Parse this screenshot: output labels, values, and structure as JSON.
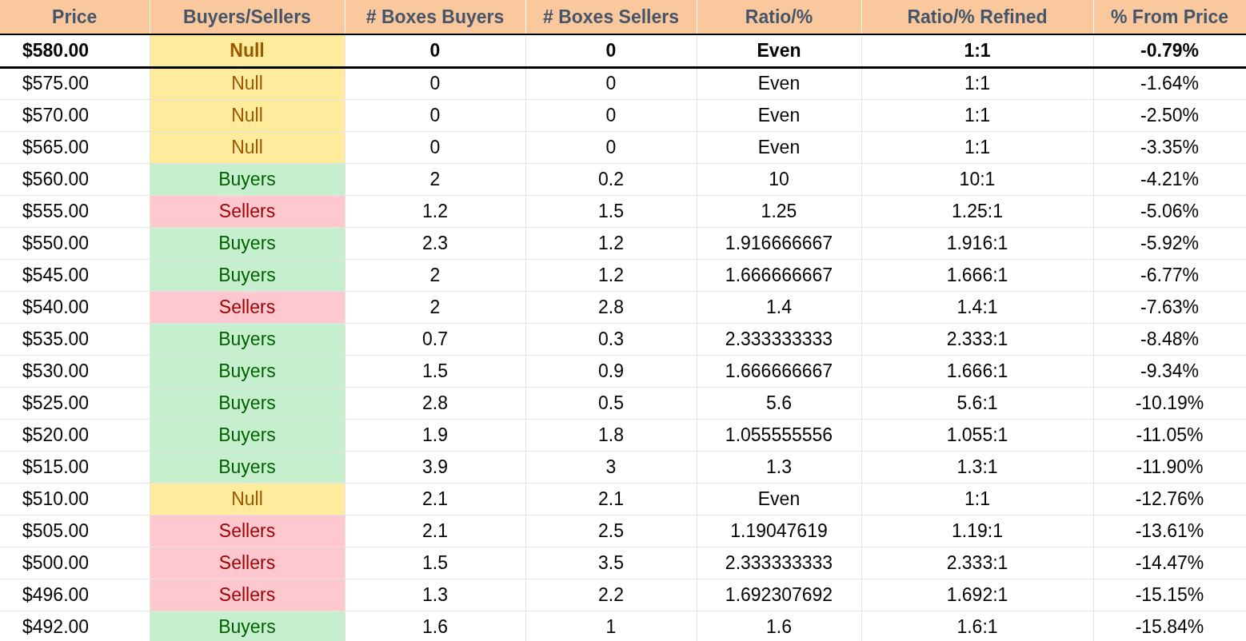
{
  "table": {
    "columns": [
      "Price",
      "Buyers/Sellers",
      "# Boxes Buyers",
      "# Boxes Sellers",
      "Ratio/%",
      "Ratio/% Refined",
      "% From Price"
    ],
    "rows": [
      {
        "current": true,
        "kind": "null",
        "cells": [
          "$580.00",
          "Null",
          "0",
          "0",
          "Even",
          "1:1",
          "-0.79%"
        ]
      },
      {
        "current": false,
        "kind": "null",
        "cells": [
          "$575.00",
          "Null",
          "0",
          "0",
          "Even",
          "1:1",
          "-1.64%"
        ]
      },
      {
        "current": false,
        "kind": "null",
        "cells": [
          "$570.00",
          "Null",
          "0",
          "0",
          "Even",
          "1:1",
          "-2.50%"
        ]
      },
      {
        "current": false,
        "kind": "null",
        "cells": [
          "$565.00",
          "Null",
          "0",
          "0",
          "Even",
          "1:1",
          "-3.35%"
        ]
      },
      {
        "current": false,
        "kind": "buyers",
        "cells": [
          "$560.00",
          "Buyers",
          "2",
          "0.2",
          "10",
          "10:1",
          "-4.21%"
        ]
      },
      {
        "current": false,
        "kind": "sellers",
        "cells": [
          "$555.00",
          "Sellers",
          "1.2",
          "1.5",
          "1.25",
          "1.25:1",
          "-5.06%"
        ]
      },
      {
        "current": false,
        "kind": "buyers",
        "cells": [
          "$550.00",
          "Buyers",
          "2.3",
          "1.2",
          "1.916666667",
          "1.916:1",
          "-5.92%"
        ]
      },
      {
        "current": false,
        "kind": "buyers",
        "cells": [
          "$545.00",
          "Buyers",
          "2",
          "1.2",
          "1.666666667",
          "1.666:1",
          "-6.77%"
        ]
      },
      {
        "current": false,
        "kind": "sellers",
        "cells": [
          "$540.00",
          "Sellers",
          "2",
          "2.8",
          "1.4",
          "1.4:1",
          "-7.63%"
        ]
      },
      {
        "current": false,
        "kind": "buyers",
        "cells": [
          "$535.00",
          "Buyers",
          "0.7",
          "0.3",
          "2.333333333",
          "2.333:1",
          "-8.48%"
        ]
      },
      {
        "current": false,
        "kind": "buyers",
        "cells": [
          "$530.00",
          "Buyers",
          "1.5",
          "0.9",
          "1.666666667",
          "1.666:1",
          "-9.34%"
        ]
      },
      {
        "current": false,
        "kind": "buyers",
        "cells": [
          "$525.00",
          "Buyers",
          "2.8",
          "0.5",
          "5.6",
          "5.6:1",
          "-10.19%"
        ]
      },
      {
        "current": false,
        "kind": "buyers",
        "cells": [
          "$520.00",
          "Buyers",
          "1.9",
          "1.8",
          "1.055555556",
          "1.055:1",
          "-11.05%"
        ]
      },
      {
        "current": false,
        "kind": "buyers",
        "cells": [
          "$515.00",
          "Buyers",
          "3.9",
          "3",
          "1.3",
          "1.3:1",
          "-11.90%"
        ]
      },
      {
        "current": false,
        "kind": "null",
        "cells": [
          "$510.00",
          "Null",
          "2.1",
          "2.1",
          "Even",
          "1:1",
          "-12.76%"
        ]
      },
      {
        "current": false,
        "kind": "sellers",
        "cells": [
          "$505.00",
          "Sellers",
          "2.1",
          "2.5",
          "1.19047619",
          "1.19:1",
          "-13.61%"
        ]
      },
      {
        "current": false,
        "kind": "sellers",
        "cells": [
          "$500.00",
          "Sellers",
          "1.5",
          "3.5",
          "2.333333333",
          "2.333:1",
          "-14.47%"
        ]
      },
      {
        "current": false,
        "kind": "sellers",
        "cells": [
          "$496.00",
          "Sellers",
          "1.3",
          "2.2",
          "1.692307692",
          "1.692:1",
          "-15.15%"
        ]
      },
      {
        "current": false,
        "kind": "buyers",
        "cells": [
          "$492.00",
          "Buyers",
          "1.6",
          "1",
          "1.6",
          "1.6:1",
          "-15.84%"
        ]
      }
    ]
  }
}
